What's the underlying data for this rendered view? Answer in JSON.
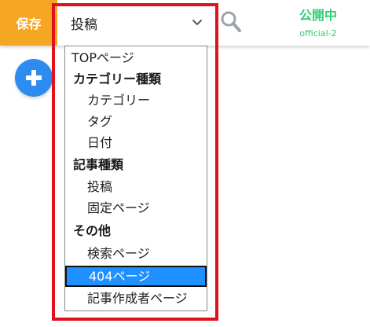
{
  "toolbar": {
    "save_label": "保存",
    "template_select_value": "投稿",
    "status_label": "公開中",
    "status_sub": "official-2"
  },
  "colors": {
    "save_button": "#f5a623",
    "add_button": "#2d8cf0",
    "status_text": "#2ecc71",
    "selected_option": "#1e90ff",
    "highlight_frame": "#e0131d"
  },
  "icons": {
    "chevron": "chevron-down-icon",
    "search": "search-icon",
    "add": "plus-icon"
  },
  "dropdown": {
    "options": [
      {
        "label": "TOPページ",
        "kind": "item"
      },
      {
        "label": "カテゴリー種類",
        "kind": "group"
      },
      {
        "label": "カテゴリー",
        "kind": "child"
      },
      {
        "label": "タグ",
        "kind": "child"
      },
      {
        "label": "日付",
        "kind": "child"
      },
      {
        "label": "記事種類",
        "kind": "group"
      },
      {
        "label": "投稿",
        "kind": "child"
      },
      {
        "label": "固定ページ",
        "kind": "child"
      },
      {
        "label": "その他",
        "kind": "group"
      },
      {
        "label": "検索ページ",
        "kind": "child"
      },
      {
        "label": "404ページ",
        "kind": "child",
        "selected": true
      },
      {
        "label": "記事作成者ページ",
        "kind": "child"
      }
    ]
  }
}
